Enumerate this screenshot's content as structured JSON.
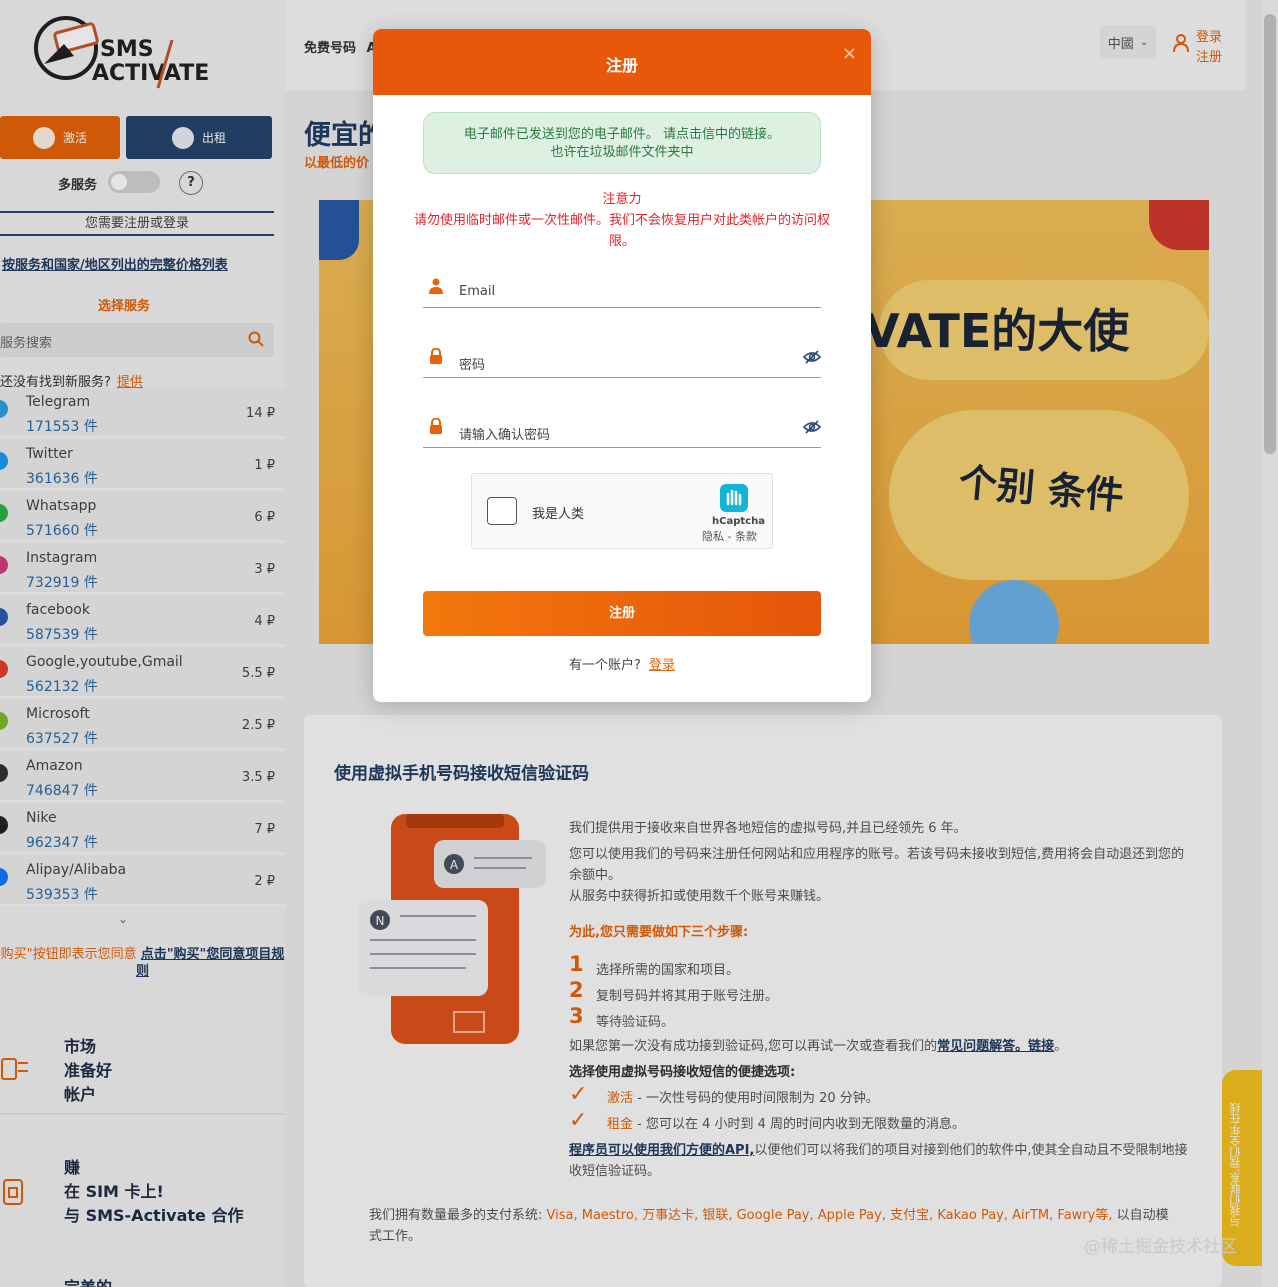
{
  "sidebar": {
    "logo_text_top": "SMS",
    "logo_text_bottom": "ACTIVATE",
    "btn_activate": "激活",
    "btn_rent": "出租",
    "multi_service": "多服务",
    "help": "?",
    "need_login": "您需要注册或登录",
    "price_list_link": "按服务和国家/地区列出的完整价格列表",
    "choose_service": "选择服务",
    "search_placeholder": "服务搜索",
    "not_found": "还没有找到新服务?",
    "suggest": "提供",
    "services": [
      {
        "name": "Telegram",
        "count": "171553 件",
        "price": "14 ₽",
        "color": "#2aa3e0"
      },
      {
        "name": "Twitter",
        "count": "361636 件",
        "price": "1 ₽",
        "color": "#1d9bf0"
      },
      {
        "name": "Whatsapp",
        "count": "571660 件",
        "price": "6 ₽",
        "color": "#29b14a"
      },
      {
        "name": "Instagram",
        "count": "732919 件",
        "price": "3 ₽",
        "color": "#d63c7a"
      },
      {
        "name": "facebook",
        "count": "587539 件",
        "price": "4 ₽",
        "color": "#2b5cb3"
      },
      {
        "name": "Google,youtube,Gmail",
        "count": "562132 件",
        "price": "5.5 ₽",
        "color": "#e2402f"
      },
      {
        "name": "Microsoft",
        "count": "637527 件",
        "price": "2.5 ₽",
        "color": "#7fb92a"
      },
      {
        "name": "Amazon",
        "count": "746847 件",
        "price": "3.5 ₽",
        "color": "#333333"
      },
      {
        "name": "Nike",
        "count": "962347 件",
        "price": "7 ₽",
        "color": "#222222"
      },
      {
        "name": "Alipay/Alibaba",
        "count": "539353 件",
        "price": "2 ₽",
        "color": "#1677ff"
      }
    ],
    "rules_pre": "购买\"按钮即表示您同意",
    "rules_link": "点击\"购买\"您同意项目规则",
    "promo1": [
      "市场",
      "准备好",
      "帐户"
    ],
    "promo2": [
      "赚",
      "在 SIM 卡上!",
      "与 SMS-Activate 合作"
    ],
    "promo3": "完美的"
  },
  "header": {
    "free_numbers": "免费号码",
    "extra": "A",
    "lang": "中國",
    "login": "登录",
    "register": "注册"
  },
  "main": {
    "h1": "便宜的",
    "h1_sub": "以最低的价",
    "banner_t1": "VATE的大使",
    "banner_t2": "个别 条件",
    "card_title": "使用虚拟手机号码接收短信验证码",
    "p1": "我们提供用于接收来自世界各地短信的虚拟号码,并且已经领先 6 年。",
    "p2": "您可以使用我们的号码来注册任何网站和应用程序的账号。若该号码未接收到短信,费用将会自动退还到您的余额中。",
    "p3": "从服务中获得折扣或使用数千个账号来赚钱。",
    "steps_title": "为此,您只需要做如下三个步骤:",
    "steps": [
      {
        "n": "1",
        "t": "选择所需的国家和项目。"
      },
      {
        "n": "2",
        "t": "复制号码并将其用于账号注册。"
      },
      {
        "n": "3",
        "t": "等待验证码。"
      }
    ],
    "retry_pre": "如果您第一次没有成功接到验证码,您可以再试一次或查看我们的",
    "faq_link": "常见问题解答。链接",
    "options_title": "选择使用虚拟号码接收短信的便捷选项:",
    "opt1_key": "激活",
    "opt1_text": " - 一次性号码的使用时间限制为 20 分钟。",
    "opt2_key": "租金",
    "opt2_text": " - 您可以在 4 小时到 4 周的时间内收到无限数量的消息。",
    "api_link": "程序员可以使用我们方便的API,",
    "api_text": "以便他们可以将我们的项目对接到他们的软件中,使其全自动且不受限制地接收短信验证码。",
    "payments_pre": "我们拥有数量最多的支付系统:",
    "payments_list": "Visa, Maestro, 万事达卡, 银联, Google Pay, Apple Pay, 支付宝, Kakao Pay, AirTM, Fawry等,",
    "payments_post": "以自动模式工作。",
    "phone_a": "A",
    "phone_n": "N",
    "feedback": "与我们联系,我们全年在线",
    "watermark": "@稀土掘金技术社区"
  },
  "modal": {
    "title": "注册",
    "close": "×",
    "notice_line1": "电子邮件已发送到您的电子邮件。 请点击信中的链接。",
    "notice_line2": "也许在垃圾邮件文件夹中",
    "warn_title": "注意力",
    "warn_body": "请勿使用临时邮件或一次性邮件。我们不会恢复用户对此类帐户的访问权限。",
    "email_placeholder": "Email",
    "password_placeholder": "密码",
    "confirm_placeholder": "请输入确认密码",
    "captcha_label": "我是人类",
    "captcha_brand": "hCaptcha",
    "captcha_links": "隐私 - 条款",
    "submit": "注册",
    "have_account": "有一个账户?",
    "login_link": "登录"
  }
}
